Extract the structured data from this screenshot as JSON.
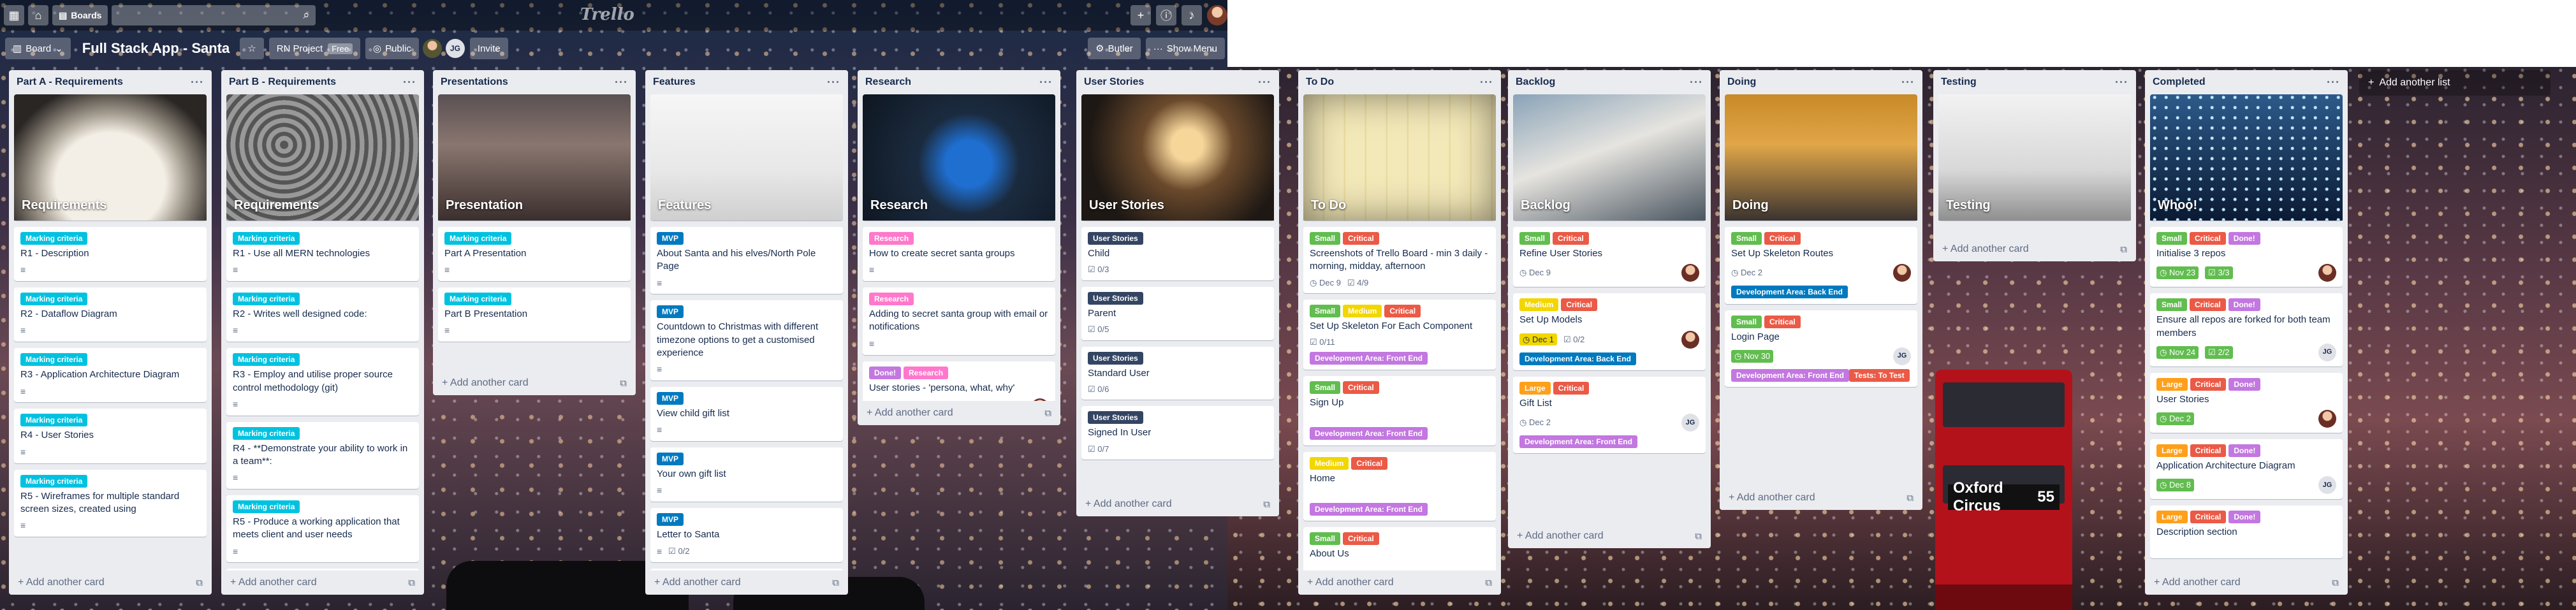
{
  "topbar": {
    "boards_label": "Boards",
    "logo": "Trello"
  },
  "board": {
    "switcher_label": "Board",
    "title": "Full Stack App - Santa",
    "team": "RN Project",
    "team_badge": "Free",
    "visibility": "Public",
    "member_initials": "JG",
    "invite_label": "Invite",
    "butler_label": "Butler",
    "show_menu_label": "Show Menu"
  },
  "add_card_label": "Add another card",
  "add_list_label": "Add another list",
  "bus_sign": {
    "route": "Oxford Circus",
    "number": "55"
  },
  "lists": [
    {
      "title": "Part A - Requirements",
      "cover": "Requirements",
      "cards": [
        {
          "labels": [
            "Marking criteria"
          ],
          "title": "R1 - Description"
        },
        {
          "labels": [
            "Marking criteria"
          ],
          "title": "R2 - Dataflow Diagram"
        },
        {
          "labels": [
            "Marking criteria"
          ],
          "title": "R3 - Application Architecture Diagram"
        },
        {
          "labels": [
            "Marking criteria"
          ],
          "title": "R4 - User Stories"
        },
        {
          "labels": [
            "Marking criteria"
          ],
          "title": "R5 - Wireframes for multiple standard screen sizes, created using"
        }
      ]
    },
    {
      "title": "Part B - Requirements",
      "cover": "Requirements",
      "cards": [
        {
          "labels": [
            "Marking criteria"
          ],
          "title": "R1 - Use all MERN technologies"
        },
        {
          "labels": [
            "Marking criteria"
          ],
          "title": "R2 - Writes well designed code:"
        },
        {
          "labels": [
            "Marking criteria"
          ],
          "title": "R3 - Employ and utilise proper source control methodology (git)"
        },
        {
          "labels": [
            "Marking criteria"
          ],
          "title": "R4 - **Demonstrate your ability to work in a team**:"
        },
        {
          "labels": [
            "Marking criteria"
          ],
          "title": "R5 - Produce a working application that meets client and user needs"
        },
        {
          "labels": [
            "Marking criteria"
          ],
          "title": ""
        }
      ]
    },
    {
      "title": "Presentations",
      "cover": "Presentation",
      "cards": [
        {
          "labels": [
            "Marking criteria"
          ],
          "title": "Part A Presentation"
        },
        {
          "labels": [
            "Marking criteria"
          ],
          "title": "Part B Presentation"
        }
      ]
    },
    {
      "title": "Features",
      "cover": "Features",
      "cards": [
        {
          "labels": [
            "MVP"
          ],
          "title": "About Santa and his elves/North Pole Page"
        },
        {
          "labels": [
            "MVP"
          ],
          "title": "Countdown to Christmas with different timezone options to get a customised experience"
        },
        {
          "labels": [
            "MVP"
          ],
          "title": "View child gift list"
        },
        {
          "labels": [
            "MVP"
          ],
          "title": "Your own gift list"
        },
        {
          "labels": [
            "MVP"
          ],
          "title": "Letter to Santa",
          "checklist": "0/2"
        },
        {
          "labels": [
            "MVP"
          ],
          "title": ""
        }
      ]
    },
    {
      "title": "Research",
      "cover": "Research",
      "cards": [
        {
          "labels": [
            "Research"
          ],
          "title": "How to create secret santa groups"
        },
        {
          "labels": [
            "Research"
          ],
          "title": "Adding to secret santa group with email or notifications"
        },
        {
          "labels": [
            "Done!",
            "Research"
          ],
          "title": "User stories - 'persona, what, why'"
        }
      ]
    },
    {
      "title": "User Stories",
      "cover": "User Stories",
      "cards": [
        {
          "labels": [
            "User Stories"
          ],
          "title": "Child",
          "checklist": "0/3"
        },
        {
          "labels": [
            "User Stories"
          ],
          "title": "Parent",
          "checklist": "0/5"
        },
        {
          "labels": [
            "User Stories"
          ],
          "title": "Standard User",
          "checklist": "0/6"
        },
        {
          "labels": [
            "User Stories"
          ],
          "title": "Signed In User",
          "checklist": "0/7"
        }
      ]
    },
    {
      "title": "To Do",
      "cover": "To Do",
      "cards": [
        {
          "labels": [
            "Small",
            "Critical"
          ],
          "title": "Screenshots of Trello Board - min 3 daily - morning, midday, afternoon",
          "due": "Dec 9",
          "checklist": "4/9"
        },
        {
          "labels": [
            "Small",
            "Medium",
            "Critical"
          ],
          "title": "Set Up Skeleton For Each Component",
          "checklist": "0/11",
          "extra": "Development Area: Front End"
        },
        {
          "labels": [
            "Small",
            "Critical"
          ],
          "title": "Sign Up",
          "extra": "Development Area: Front End"
        },
        {
          "labels": [
            "Medium",
            "Critical"
          ],
          "title": "Home",
          "extra": "Development Area: Front End"
        },
        {
          "labels": [
            "Small",
            "Critical"
          ],
          "title": "About Us"
        }
      ]
    },
    {
      "title": "Backlog",
      "cover": "Backlog",
      "cards": [
        {
          "labels": [
            "Small",
            "Critical"
          ],
          "title": "Refine User Stories",
          "due": "Dec 9"
        },
        {
          "labels": [
            "Medium",
            "Critical"
          ],
          "title": "Set Up Models",
          "due": "Dec 1",
          "checklist": "0/2",
          "extra": "Development Area: Back End"
        },
        {
          "labels": [
            "Large",
            "Critical"
          ],
          "title": "Gift List",
          "due": "Dec 2",
          "extra": "Development Area: Front End"
        }
      ]
    },
    {
      "title": "Doing",
      "cover": "Doing",
      "cards": [
        {
          "labels": [
            "Small",
            "Critical"
          ],
          "title": "Set Up Skeleton Routes",
          "due": "Dec 2",
          "extra": "Development Area: Back End"
        },
        {
          "labels": [
            "Small",
            "Critical"
          ],
          "title": "Login Page",
          "due": "Nov 30",
          "extra": "Development Area: Front End",
          "extra2": "Tests: To Test"
        }
      ]
    },
    {
      "title": "Testing",
      "cover": "Testing",
      "cards": []
    },
    {
      "title": "Completed",
      "cover": "Whoo!",
      "cards": [
        {
          "labels": [
            "Small",
            "Critical",
            "Done!"
          ],
          "title": "Initialise 3 repos",
          "due": "Nov 23",
          "checklist": "3/3"
        },
        {
          "labels": [
            "Small",
            "Critical",
            "Done!"
          ],
          "title": "Ensure all repos are forked for both team members",
          "due": "Nov 24",
          "checklist": "2/2"
        },
        {
          "labels": [
            "Large",
            "Critical",
            "Done!"
          ],
          "title": "User Stories",
          "due": "Dec 2"
        },
        {
          "labels": [
            "Large",
            "Critical",
            "Done!"
          ],
          "title": "Application Architecture Diagram",
          "due": "Dec 8"
        },
        {
          "labels": [
            "Large",
            "Critical",
            "Done!"
          ],
          "title": "Description section"
        }
      ]
    }
  ]
}
